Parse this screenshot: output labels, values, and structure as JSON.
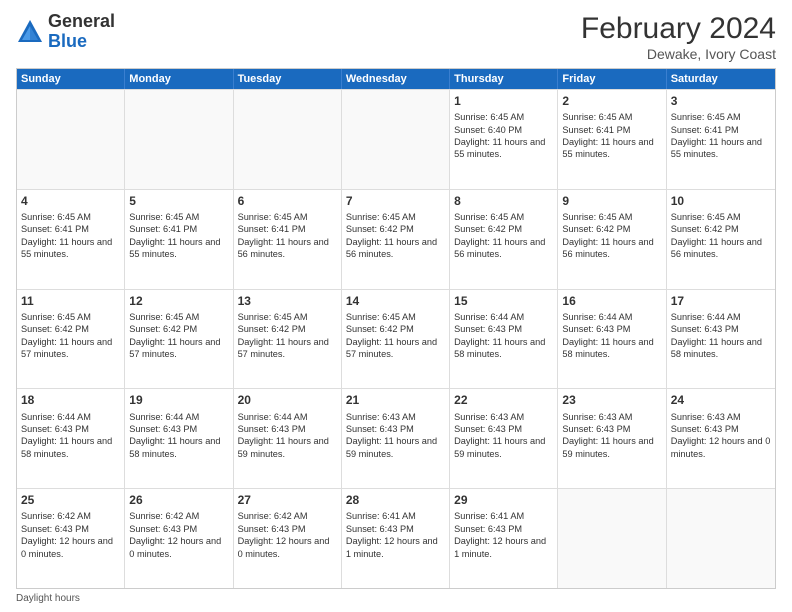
{
  "logo": {
    "general": "General",
    "blue": "Blue"
  },
  "title": {
    "month": "February 2024",
    "location": "Dewake, Ivory Coast"
  },
  "header_days": [
    "Sunday",
    "Monday",
    "Tuesday",
    "Wednesday",
    "Thursday",
    "Friday",
    "Saturday"
  ],
  "weeks": [
    [
      {
        "day": "",
        "info": ""
      },
      {
        "day": "",
        "info": ""
      },
      {
        "day": "",
        "info": ""
      },
      {
        "day": "",
        "info": ""
      },
      {
        "day": "1",
        "info": "Sunrise: 6:45 AM\nSunset: 6:40 PM\nDaylight: 11 hours and 55 minutes."
      },
      {
        "day": "2",
        "info": "Sunrise: 6:45 AM\nSunset: 6:41 PM\nDaylight: 11 hours and 55 minutes."
      },
      {
        "day": "3",
        "info": "Sunrise: 6:45 AM\nSunset: 6:41 PM\nDaylight: 11 hours and 55 minutes."
      }
    ],
    [
      {
        "day": "4",
        "info": "Sunrise: 6:45 AM\nSunset: 6:41 PM\nDaylight: 11 hours and 55 minutes."
      },
      {
        "day": "5",
        "info": "Sunrise: 6:45 AM\nSunset: 6:41 PM\nDaylight: 11 hours and 55 minutes."
      },
      {
        "day": "6",
        "info": "Sunrise: 6:45 AM\nSunset: 6:41 PM\nDaylight: 11 hours and 56 minutes."
      },
      {
        "day": "7",
        "info": "Sunrise: 6:45 AM\nSunset: 6:42 PM\nDaylight: 11 hours and 56 minutes."
      },
      {
        "day": "8",
        "info": "Sunrise: 6:45 AM\nSunset: 6:42 PM\nDaylight: 11 hours and 56 minutes."
      },
      {
        "day": "9",
        "info": "Sunrise: 6:45 AM\nSunset: 6:42 PM\nDaylight: 11 hours and 56 minutes."
      },
      {
        "day": "10",
        "info": "Sunrise: 6:45 AM\nSunset: 6:42 PM\nDaylight: 11 hours and 56 minutes."
      }
    ],
    [
      {
        "day": "11",
        "info": "Sunrise: 6:45 AM\nSunset: 6:42 PM\nDaylight: 11 hours and 57 minutes."
      },
      {
        "day": "12",
        "info": "Sunrise: 6:45 AM\nSunset: 6:42 PM\nDaylight: 11 hours and 57 minutes."
      },
      {
        "day": "13",
        "info": "Sunrise: 6:45 AM\nSunset: 6:42 PM\nDaylight: 11 hours and 57 minutes."
      },
      {
        "day": "14",
        "info": "Sunrise: 6:45 AM\nSunset: 6:42 PM\nDaylight: 11 hours and 57 minutes."
      },
      {
        "day": "15",
        "info": "Sunrise: 6:44 AM\nSunset: 6:43 PM\nDaylight: 11 hours and 58 minutes."
      },
      {
        "day": "16",
        "info": "Sunrise: 6:44 AM\nSunset: 6:43 PM\nDaylight: 11 hours and 58 minutes."
      },
      {
        "day": "17",
        "info": "Sunrise: 6:44 AM\nSunset: 6:43 PM\nDaylight: 11 hours and 58 minutes."
      }
    ],
    [
      {
        "day": "18",
        "info": "Sunrise: 6:44 AM\nSunset: 6:43 PM\nDaylight: 11 hours and 58 minutes."
      },
      {
        "day": "19",
        "info": "Sunrise: 6:44 AM\nSunset: 6:43 PM\nDaylight: 11 hours and 58 minutes."
      },
      {
        "day": "20",
        "info": "Sunrise: 6:44 AM\nSunset: 6:43 PM\nDaylight: 11 hours and 59 minutes."
      },
      {
        "day": "21",
        "info": "Sunrise: 6:43 AM\nSunset: 6:43 PM\nDaylight: 11 hours and 59 minutes."
      },
      {
        "day": "22",
        "info": "Sunrise: 6:43 AM\nSunset: 6:43 PM\nDaylight: 11 hours and 59 minutes."
      },
      {
        "day": "23",
        "info": "Sunrise: 6:43 AM\nSunset: 6:43 PM\nDaylight: 11 hours and 59 minutes."
      },
      {
        "day": "24",
        "info": "Sunrise: 6:43 AM\nSunset: 6:43 PM\nDaylight: 12 hours and 0 minutes."
      }
    ],
    [
      {
        "day": "25",
        "info": "Sunrise: 6:42 AM\nSunset: 6:43 PM\nDaylight: 12 hours and 0 minutes."
      },
      {
        "day": "26",
        "info": "Sunrise: 6:42 AM\nSunset: 6:43 PM\nDaylight: 12 hours and 0 minutes."
      },
      {
        "day": "27",
        "info": "Sunrise: 6:42 AM\nSunset: 6:43 PM\nDaylight: 12 hours and 0 minutes."
      },
      {
        "day": "28",
        "info": "Sunrise: 6:41 AM\nSunset: 6:43 PM\nDaylight: 12 hours and 1 minute."
      },
      {
        "day": "29",
        "info": "Sunrise: 6:41 AM\nSunset: 6:43 PM\nDaylight: 12 hours and 1 minute."
      },
      {
        "day": "",
        "info": ""
      },
      {
        "day": "",
        "info": ""
      }
    ]
  ],
  "footer": {
    "daylight_label": "Daylight hours"
  }
}
